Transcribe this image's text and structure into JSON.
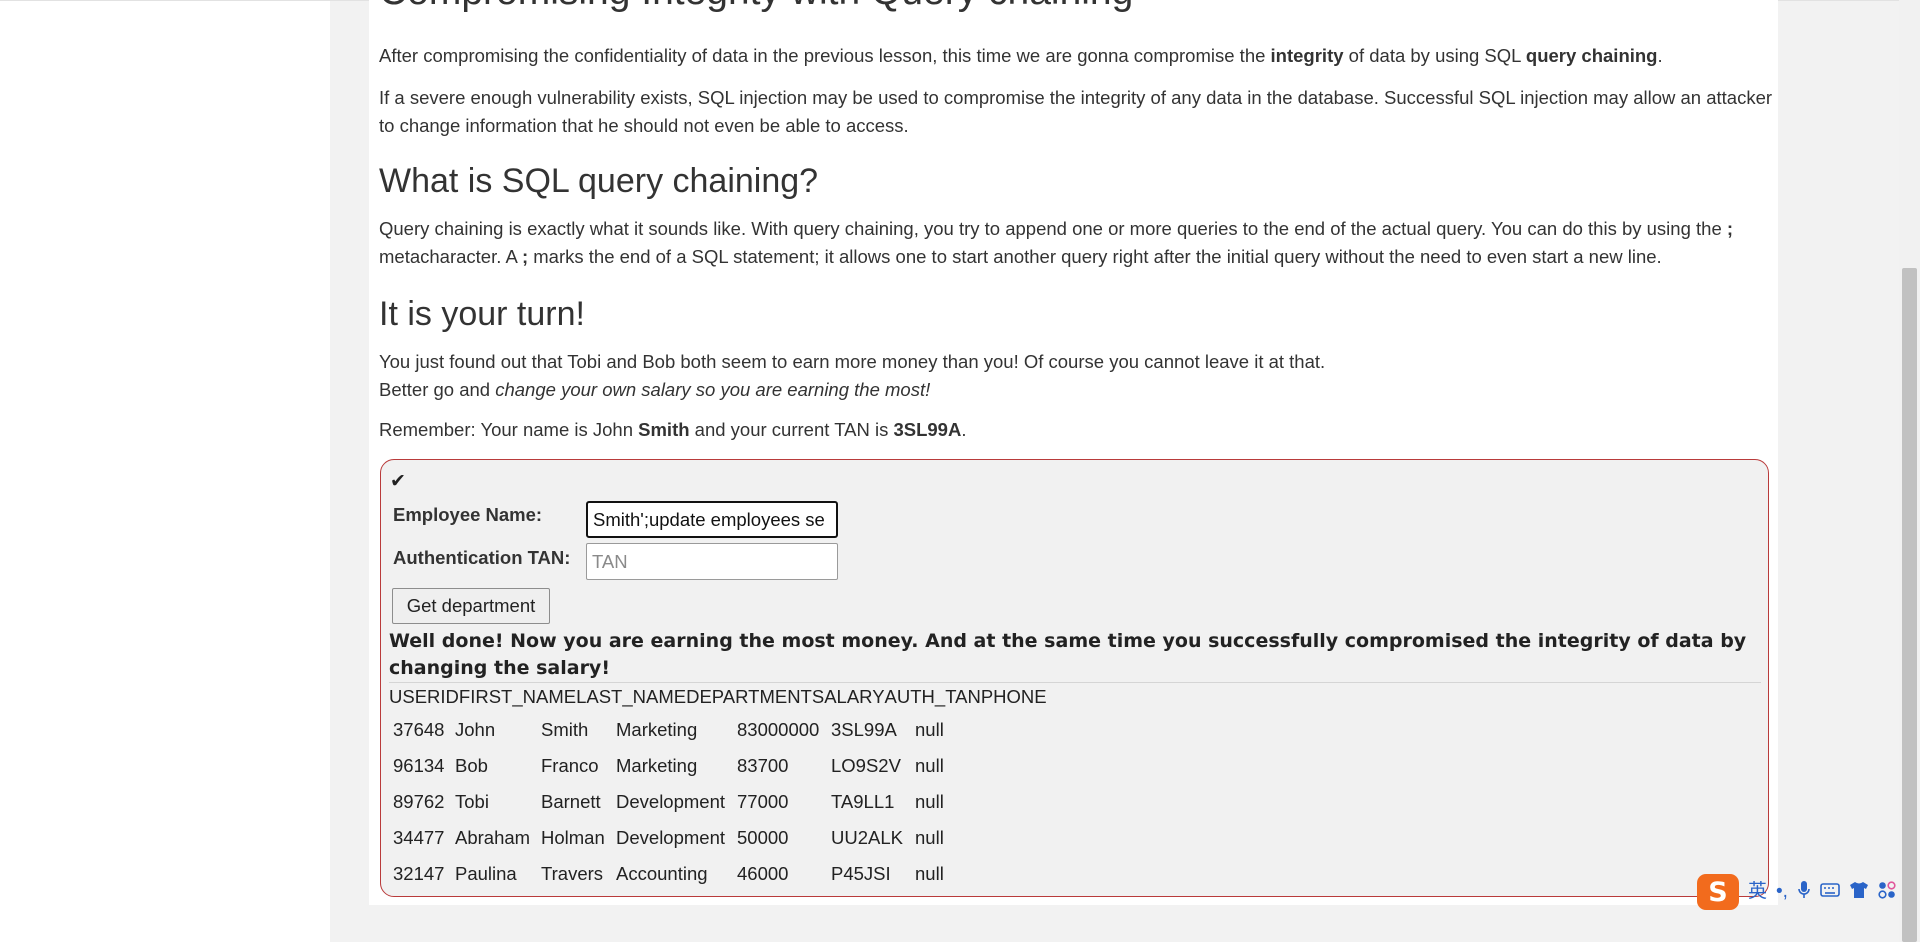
{
  "lesson": {
    "title": "Compromising Integrity with Query chaining",
    "intro_1": [
      {
        "t": "After compromising the confidentiality of data in the previous lesson, this time we are gonna compromise the "
      },
      {
        "b": "integrity"
      },
      {
        "t": " of data by using SQL "
      },
      {
        "b": "query chaining"
      },
      {
        "t": "."
      }
    ],
    "intro_2": "If a severe enough vulnerability exists, SQL injection may be used to compromise the integrity of any data in the database. Successful SQL injection may allow an attacker to change information that he should not even be able to access.",
    "section_1_heading": "What is SQL query chaining?",
    "section_1_text": [
      {
        "t": "Query chaining is exactly what it sounds like. With query chaining, you try to append one or more queries to the end of the actual query. You can do this by using the "
      },
      {
        "b": ";"
      },
      {
        "t": " metacharacter. A "
      },
      {
        "b": ";"
      },
      {
        "t": " marks the end of a SQL statement; it allows one to start another query right after the initial query without the need to even start a new line."
      }
    ],
    "section_2_heading": "It is your turn!",
    "turn_text_line1": "You just found out that Tobi and Bob both seem to earn more money than you! Of course you cannot leave it at that.",
    "turn_text_line2": [
      {
        "t": "Better go and "
      },
      {
        "i": "change your own salary so you are earning the most!"
      }
    ],
    "remember_text": [
      {
        "t": "Remember: Your name is John "
      },
      {
        "b": "Smith"
      },
      {
        "t": " and your current TAN is "
      },
      {
        "b": "3SL99A"
      },
      {
        "t": "."
      }
    ]
  },
  "form": {
    "status_icon": "checkmark-icon",
    "status_glyph": "✔",
    "name_label": "Employee Name:",
    "name_value": "Smith';update employees se",
    "tan_label": "Authentication TAN:",
    "tan_placeholder": "TAN",
    "tan_value": "",
    "submit_label": "Get department"
  },
  "feedback": {
    "message": "Well done! Now you are earning the most money. And at the same time you successfully compromised the integrity of data by changing the salary!"
  },
  "results": {
    "headers": [
      "USERID",
      "FIRST_NAME",
      "LAST_NAME",
      "DEPARTMENT",
      "SALARY",
      "AUTH_TAN",
      "PHONE"
    ],
    "rows": [
      [
        "37648",
        "John",
        "Smith",
        "Marketing",
        "83000000",
        "3SL99A",
        "null"
      ],
      [
        "96134",
        "Bob",
        "Franco",
        "Marketing",
        "83700",
        "LO9S2V",
        "null"
      ],
      [
        "89762",
        "Tobi",
        "Barnett",
        "Development",
        "77000",
        "TA9LL1",
        "null"
      ],
      [
        "34477",
        "Abraham",
        "Holman",
        "Development",
        "50000",
        "UU2ALK",
        "null"
      ],
      [
        "32147",
        "Paulina",
        "Travers",
        "Accounting",
        "46000",
        "P45JSI",
        "null"
      ]
    ]
  },
  "ime_toolbar": {
    "logo_glyph": "S",
    "lang": "英",
    "punct": "•,",
    "icons": [
      "sogou-logo-icon",
      "punctuation-icon",
      "microphone-icon",
      "keyboard-icon",
      "skin-shirt-icon",
      "toolbox-grid-icon"
    ]
  },
  "colors": {
    "box_border": "#b93b3b",
    "box_bg": "#f1f1f1",
    "page_gutter": "#f2f2f2",
    "ime_logo": "#f26b1d",
    "ime_icons": "#2a64c8"
  }
}
